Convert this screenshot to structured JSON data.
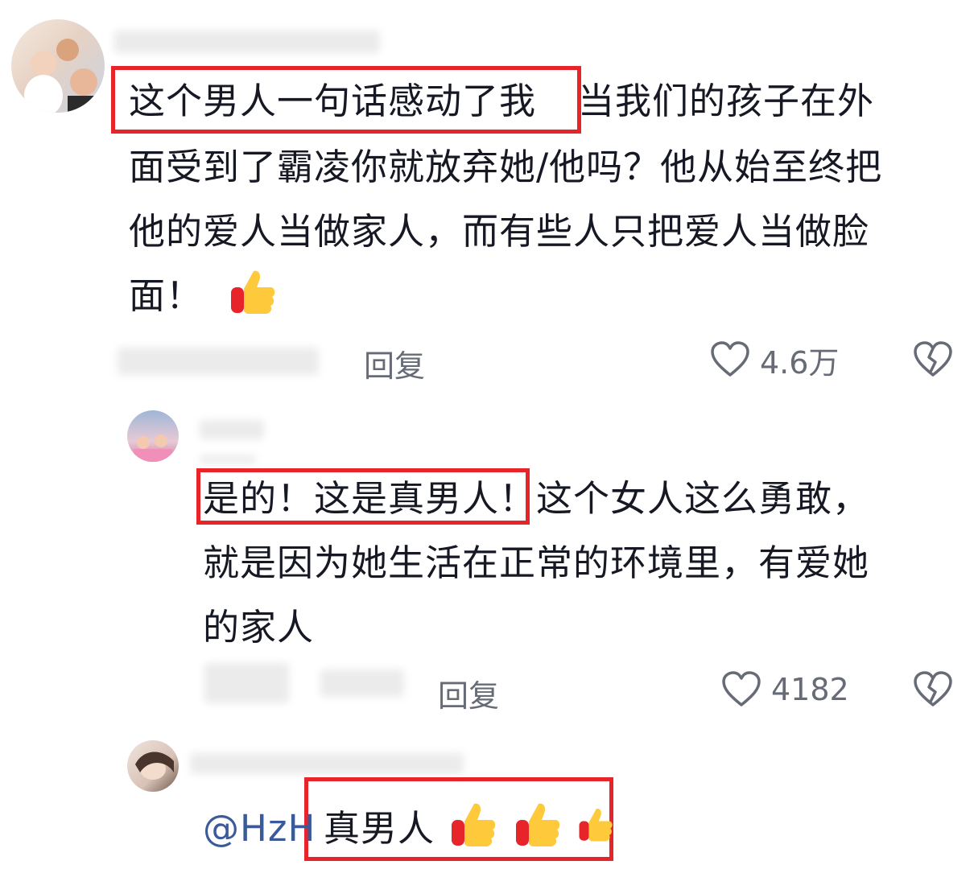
{
  "comments": [
    {
      "highlight": "这个男人一句话感动了我",
      "line1_rest": "当我们的孩子在外",
      "line2": "面受到了霸凌你就放弃她/他吗？他从始至终把",
      "line3": "他的爱人当做家人，而有些人只把爱人当做脸",
      "line4": "面！",
      "reply_label": "回复",
      "likes": "4.6万",
      "icons": [
        "heart-outline-icon",
        "broken-heart-icon",
        "thumbs-up-emoji"
      ]
    },
    {
      "highlight": "是的！这是真男人",
      "line1_rest": "！这个女人这么勇敢，",
      "line2": "就是因为她生活在正常的环境里，有爱她",
      "line3": "的家人",
      "reply_label": "回复",
      "likes": "4182"
    },
    {
      "mention": "@HzH",
      "highlight": "真男人"
    }
  ],
  "colors": {
    "highlight_border": "#e8242b",
    "mention": "#3a5a9a",
    "meta": "#666b76"
  }
}
